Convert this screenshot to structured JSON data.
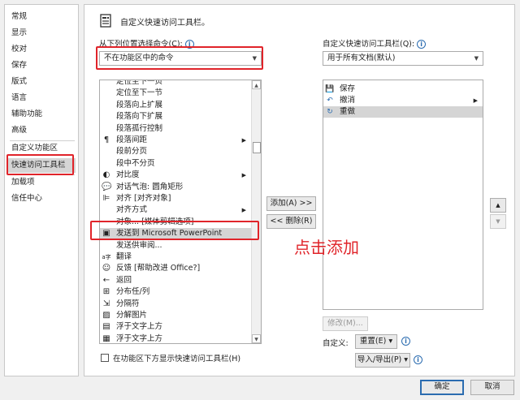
{
  "nav": {
    "items": [
      "常规",
      "显示",
      "校对",
      "保存",
      "版式",
      "语言",
      "辅助功能",
      "高级",
      "自定义功能区",
      "快速访问工具栏",
      "加载项",
      "信任中心"
    ]
  },
  "header": {
    "title": "自定义快速访问工具栏。"
  },
  "left": {
    "choose_label": "从下列位置选择命令(C):",
    "choose_value": "不在功能区中的命令",
    "commands": [
      {
        "label": "定位至下一页",
        "icon": "",
        "sub": false
      },
      {
        "label": "定位至下一节",
        "icon": "",
        "sub": false
      },
      {
        "label": "段落向上扩展",
        "icon": "",
        "sub": false
      },
      {
        "label": "段落向下扩展",
        "icon": "",
        "sub": false
      },
      {
        "label": "段落孤行控制",
        "icon": "",
        "sub": false
      },
      {
        "label": "段落间距",
        "icon": "¶",
        "sub": true
      },
      {
        "label": "段前分页",
        "icon": "",
        "sub": false
      },
      {
        "label": "段中不分页",
        "icon": "",
        "sub": false
      },
      {
        "label": "对比度",
        "icon": "◐",
        "sub": true
      },
      {
        "label": "对话气泡: 圆角矩形",
        "icon": "💬",
        "sub": false
      },
      {
        "label": "对齐 [对齐对象]",
        "icon": "⊫",
        "sub": false
      },
      {
        "label": "对齐方式",
        "icon": "",
        "sub": true
      },
      {
        "label": "对象... [媒体剪辑选项]",
        "icon": "",
        "sub": false
      },
      {
        "label": "发送到 Microsoft PowerPoint",
        "icon": "▣",
        "sub": false
      },
      {
        "label": "发送供审阅...",
        "icon": "",
        "sub": false
      },
      {
        "label": "翻译",
        "icon": "a字",
        "sub": false
      },
      {
        "label": "反馈 [帮助改进 Office?]",
        "icon": "☺",
        "sub": false
      },
      {
        "label": "返回",
        "icon": "←",
        "sub": false
      },
      {
        "label": "分布任/列",
        "icon": "⊞",
        "sub": false
      },
      {
        "label": "分隔符",
        "icon": "⇲",
        "sub": false
      },
      {
        "label": "分解图片",
        "icon": "▨",
        "sub": false
      },
      {
        "label": "浮于文字上方",
        "icon": "▤",
        "sub": false
      },
      {
        "label": "浮于文字上方",
        "icon": "▦",
        "sub": false
      }
    ],
    "checkbox_label": "在功能区下方显示快速访问工具栏(H)"
  },
  "buttons": {
    "add": "添加(A) >>",
    "remove": "<< 删除(R)",
    "modify": "修改(M)...",
    "reset_label": "自定义:",
    "reset": "重置(E) ▾",
    "import_export": "导入/导出(P) ▾",
    "ok": "确定",
    "cancel": "取消"
  },
  "right": {
    "toolbar_label": "自定义快速访问工具栏(Q):",
    "toolbar_value": "用于所有文档(默认)",
    "items": [
      {
        "label": "保存",
        "icon": "💾"
      },
      {
        "label": "撤消",
        "icon": "↶"
      },
      {
        "label": "重做",
        "icon": "↻"
      }
    ]
  },
  "annotation": {
    "text": "点击添加",
    "color": "#e0242a"
  },
  "colors": {
    "accent": "#2b6cb0",
    "highlight": "#e0242a",
    "selected": "#d5d5d5"
  }
}
